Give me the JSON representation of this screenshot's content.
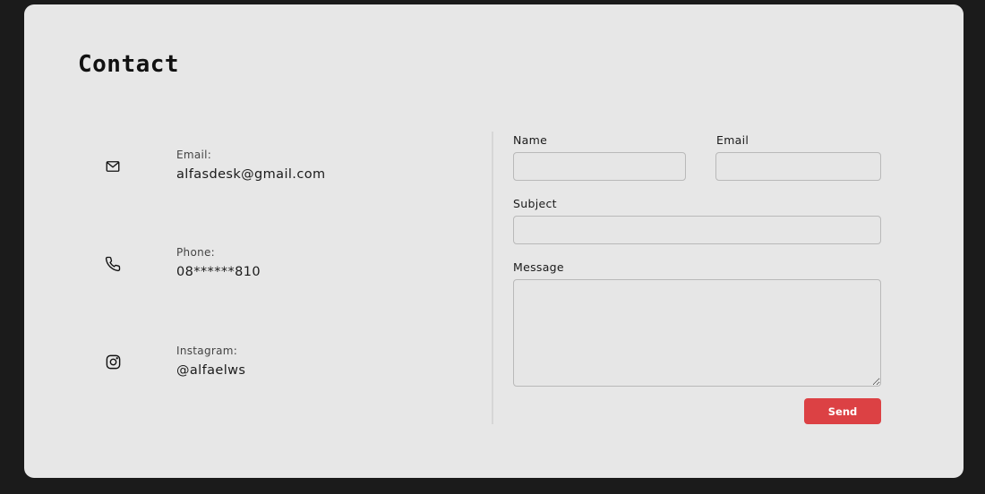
{
  "page": {
    "title": "Contact"
  },
  "contact_info": {
    "items": [
      {
        "icon": "mail-icon",
        "label": "Email:",
        "value": "alfasdesk@gmail.com"
      },
      {
        "icon": "phone-icon",
        "label": "Phone:",
        "value": "08******810"
      },
      {
        "icon": "instagram-icon",
        "label": "Instagram:",
        "value": "@alfaelws"
      }
    ]
  },
  "form": {
    "name_label": "Name",
    "name_value": "",
    "email_label": "Email",
    "email_value": "",
    "subject_label": "Subject",
    "subject_value": "",
    "message_label": "Message",
    "message_value": "",
    "send_label": "Send"
  },
  "colors": {
    "background": "#1b1b1b",
    "card": "#e7e7e7",
    "accent": "#dc4144"
  }
}
